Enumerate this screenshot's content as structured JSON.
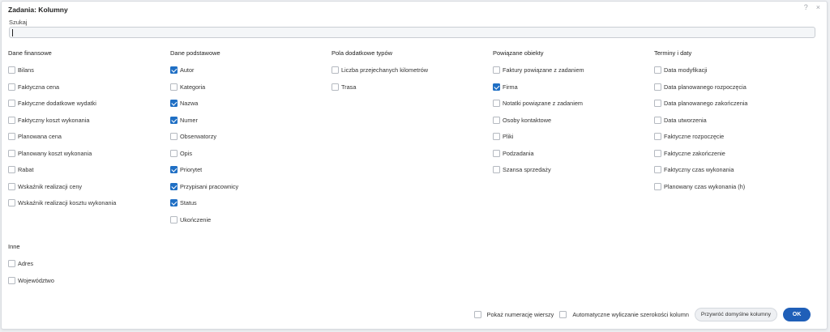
{
  "dialog": {
    "title": "Zadania: Kolumny",
    "help_icon": "?",
    "close_icon": "×"
  },
  "search": {
    "label": "Szukaj",
    "value": "",
    "placeholder": ""
  },
  "groups": [
    {
      "title": "Dane finansowe",
      "items": [
        {
          "label": "Bilans",
          "checked": false
        },
        {
          "label": "Faktyczna cena",
          "checked": false
        },
        {
          "label": "Faktyczne dodatkowe wydatki",
          "checked": false
        },
        {
          "label": "Faktyczny koszt wykonania",
          "checked": false
        },
        {
          "label": "Planowana cena",
          "checked": false
        },
        {
          "label": "Planowany koszt wykonania",
          "checked": false
        },
        {
          "label": "Rabat",
          "checked": false
        },
        {
          "label": "Wskaźnik realizacji ceny",
          "checked": false
        },
        {
          "label": "Wskaźnik realizacji kosztu wykonania",
          "checked": false
        }
      ]
    },
    {
      "title": "Dane podstawowe",
      "items": [
        {
          "label": "Autor",
          "checked": true
        },
        {
          "label": "Kategoria",
          "checked": false
        },
        {
          "label": "Nazwa",
          "checked": true
        },
        {
          "label": "Numer",
          "checked": true
        },
        {
          "label": "Obserwatorzy",
          "checked": false
        },
        {
          "label": "Opis",
          "checked": false
        },
        {
          "label": "Priorytet",
          "checked": true
        },
        {
          "label": "Przypisani pracownicy",
          "checked": true
        },
        {
          "label": "Status",
          "checked": true
        },
        {
          "label": "Ukończenie",
          "checked": false
        }
      ]
    },
    {
      "title": "Pola dodatkowe typów",
      "items": [
        {
          "label": "Liczba przejechanych kilometrów",
          "checked": false
        },
        {
          "label": "Trasa",
          "checked": false
        }
      ]
    },
    {
      "title": "Powiązane obiekty",
      "items": [
        {
          "label": "Faktury powiązane z zadaniem",
          "checked": false
        },
        {
          "label": "Firma",
          "checked": true
        },
        {
          "label": "Notatki powiązane z zadaniem",
          "checked": false
        },
        {
          "label": "Osoby kontaktowe",
          "checked": false
        },
        {
          "label": "Pliki",
          "checked": false
        },
        {
          "label": "Podzadania",
          "checked": false
        },
        {
          "label": "Szansa sprzedaży",
          "checked": false
        }
      ]
    },
    {
      "title": "Terminy i daty",
      "items": [
        {
          "label": "Data modyfikacji",
          "checked": false
        },
        {
          "label": "Data planowanego rozpoczęcia",
          "checked": false
        },
        {
          "label": "Data planowanego zakończenia",
          "checked": false
        },
        {
          "label": "Data utworzenia",
          "checked": false
        },
        {
          "label": "Faktyczne rozpoczęcie",
          "checked": false
        },
        {
          "label": "Faktyczne zakończenie",
          "checked": false
        },
        {
          "label": "Faktyczny czas wykonania",
          "checked": false
        },
        {
          "label": "Planowany czas wykonania (h)",
          "checked": false
        }
      ]
    },
    {
      "title": "Inne",
      "items": [
        {
          "label": "Adres",
          "checked": false
        },
        {
          "label": "Województwo",
          "checked": false
        }
      ]
    }
  ],
  "footer": {
    "show_row_numbers": {
      "label": "Pokaż numerację wierszy",
      "checked": false
    },
    "auto_width": {
      "label": "Automatyczne wyliczanie szerokości kolumn",
      "checked": false
    },
    "reset_label": "Przywróć domyślne kolumny",
    "ok_label": "OK"
  },
  "colors": {
    "accent": "#1f6fc4",
    "ok_button": "#1f5fb8"
  }
}
